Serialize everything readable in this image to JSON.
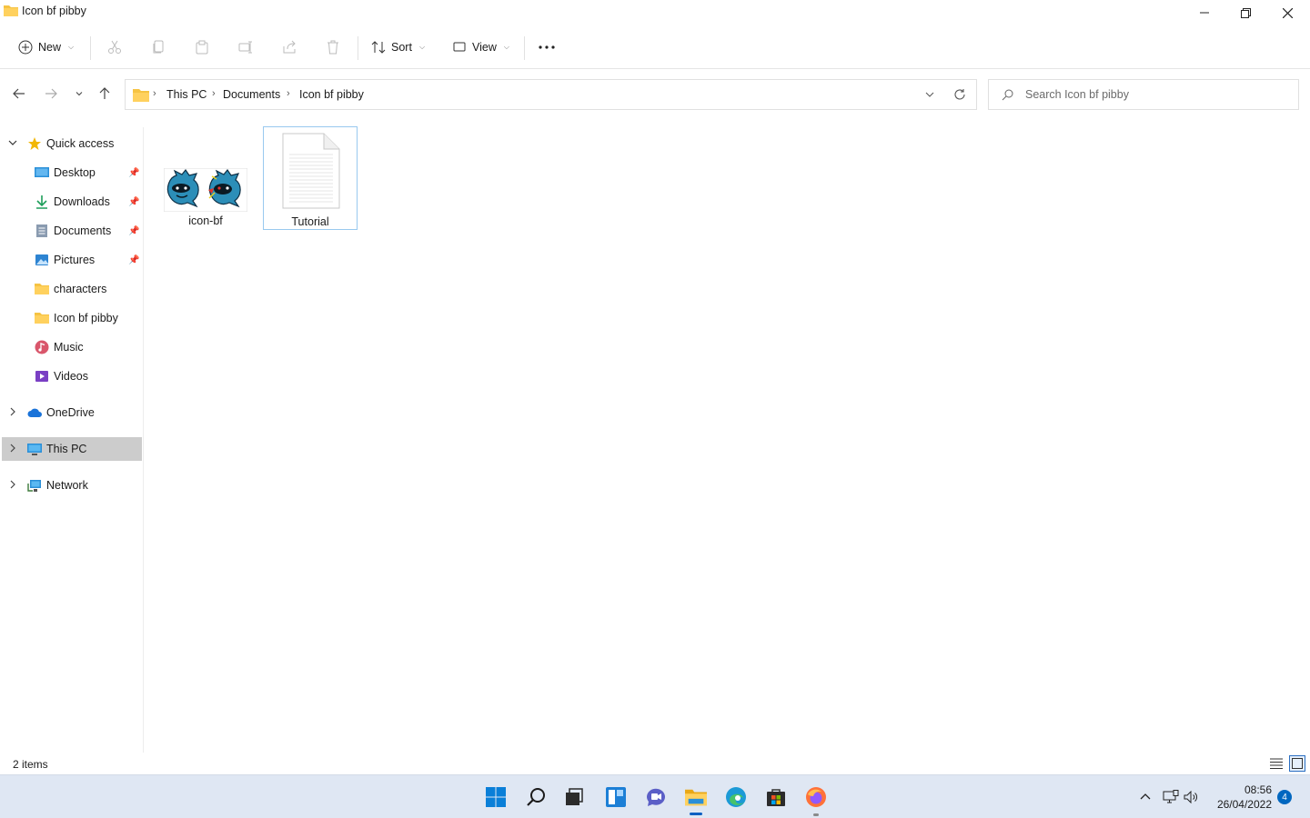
{
  "window": {
    "title": "Icon bf pibby",
    "controls": {
      "minimize": "minimize-icon",
      "maximize": "restore-icon",
      "close": "close-icon"
    }
  },
  "toolbar": {
    "new_label": "New",
    "sort_label": "Sort",
    "view_label": "View",
    "more_icon": "more-icon"
  },
  "address": {
    "crumbs": [
      "This PC",
      "Documents",
      "Icon bf pibby"
    ]
  },
  "search": {
    "placeholder": "Search Icon bf pibby"
  },
  "sidebar": {
    "items": [
      {
        "label": "Quick access",
        "icon": "star-icon"
      },
      {
        "label": "Desktop",
        "icon": "desktop-icon",
        "pinned": true
      },
      {
        "label": "Downloads",
        "icon": "download-icon",
        "pinned": true
      },
      {
        "label": "Documents",
        "icon": "document-icon",
        "pinned": true
      },
      {
        "label": "Pictures",
        "icon": "pictures-icon",
        "pinned": true
      },
      {
        "label": "characters",
        "icon": "folder-icon"
      },
      {
        "label": "Icon bf pibby",
        "icon": "folder-icon"
      },
      {
        "label": "Music",
        "icon": "music-icon"
      },
      {
        "label": "Videos",
        "icon": "videos-icon"
      },
      {
        "label": "OneDrive",
        "icon": "cloud-icon"
      },
      {
        "label": "This PC",
        "icon": "monitor-icon",
        "selected": true
      },
      {
        "label": "Network",
        "icon": "network-icon"
      }
    ]
  },
  "files": [
    {
      "name": "icon-bf",
      "type": "image"
    },
    {
      "name": "Tutorial",
      "type": "text",
      "selected": true
    }
  ],
  "status": {
    "item_count": "2 items"
  },
  "taskbar": {
    "apps": [
      "start-icon",
      "search-icon",
      "task-view-icon",
      "widgets-icon",
      "chat-icon",
      "file-explorer-icon",
      "edge-icon",
      "store-icon",
      "firefox-icon"
    ],
    "time": "08:56",
    "date": "26/04/2022",
    "notifications": "4"
  },
  "colors": {
    "accent": "#0067c0",
    "selection": "#cccccc",
    "tile_border": "#99c9ef",
    "taskbar": "#dfe7f3",
    "folder": "#f6c343"
  }
}
